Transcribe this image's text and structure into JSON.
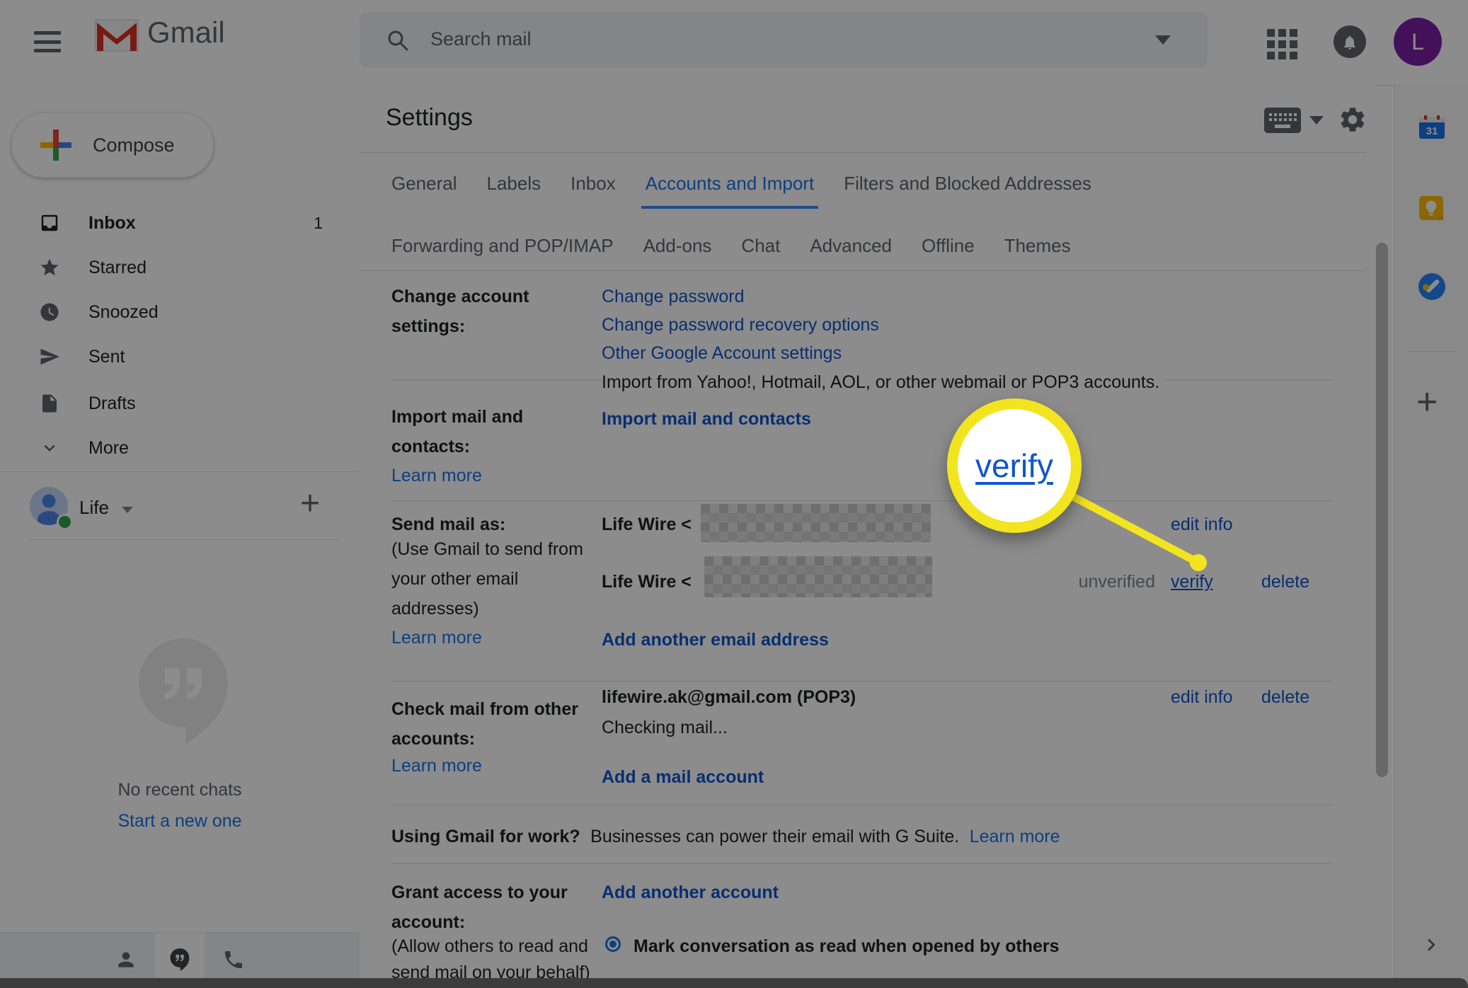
{
  "topbar": {
    "logo_text": "Gmail",
    "search_placeholder": "Search mail",
    "avatar_letter": "L"
  },
  "sidebar": {
    "compose_label": "Compose",
    "items": [
      {
        "label": "Inbox",
        "count": "1"
      },
      {
        "label": "Starred"
      },
      {
        "label": "Snoozed"
      },
      {
        "label": "Sent"
      },
      {
        "label": "Drafts"
      },
      {
        "label": "More"
      }
    ],
    "account_name": "Life",
    "chats_empty": "No recent chats",
    "chats_start_link": "Start a new one"
  },
  "settings": {
    "title": "Settings",
    "tabs_row1": [
      {
        "label": "General"
      },
      {
        "label": "Labels"
      },
      {
        "label": "Inbox"
      },
      {
        "label": "Accounts and Import"
      },
      {
        "label": "Filters and Blocked Addresses"
      }
    ],
    "tabs_row2": [
      {
        "label": "Forwarding and POP/IMAP"
      },
      {
        "label": "Add-ons"
      },
      {
        "label": "Chat"
      },
      {
        "label": "Advanced"
      },
      {
        "label": "Offline"
      },
      {
        "label": "Themes"
      }
    ],
    "change_account": {
      "label_line1": "Change account",
      "label_line2": "settings:",
      "link1": "Change password",
      "link2": "Change password recovery options",
      "link3": "Other Google Account settings"
    },
    "import_mail": {
      "intro": "Import from Yahoo!, Hotmail, AOL, or other webmail or POP3 accounts.",
      "label_line1": "Import mail and",
      "label_line2": "contacts:",
      "learn_more": "Learn more",
      "action": "Import mail and contacts"
    },
    "send_mail_as": {
      "label": "Send mail as:",
      "note_line1": "(Use Gmail to send from",
      "note_line2": "your other email",
      "note_line3": "addresses)",
      "learn_more": "Learn more",
      "entry1_name": "Life Wire <",
      "entry1_action": "edit info",
      "entry2_name": "Life Wire <",
      "entry2_status": "unverified",
      "entry2_verify": "verify",
      "entry2_delete": "delete",
      "add_link": "Add another email address"
    },
    "check_mail": {
      "label_line1": "Check mail from other",
      "label_line2": "accounts:",
      "learn_more": "Learn more",
      "account": "lifewire.ak@gmail.com (POP3)",
      "status": "Checking mail...",
      "edit_info": "edit info",
      "delete": "delete",
      "add_link": "Add a mail account"
    },
    "work": {
      "label": "Using Gmail for work?",
      "text": "Businesses can power their email with G Suite.",
      "learn_more": "Learn more"
    },
    "grant_access": {
      "label_line1": "Grant access to your",
      "label_line2": "account:",
      "note_line1": "(Allow others to read and",
      "note_line2": "send mail on your behalf)",
      "add_link": "Add another account",
      "option": "Mark conversation as read when opened by others"
    }
  },
  "right_rail": {
    "calendar_day": "31"
  },
  "callout": {
    "label": "verify"
  },
  "colors": {
    "accent_blue": "#1a73e8",
    "link_blue": "#1155cc",
    "highlight_yellow": "#f2e41f",
    "avatar_purple": "#7b1fa2"
  }
}
